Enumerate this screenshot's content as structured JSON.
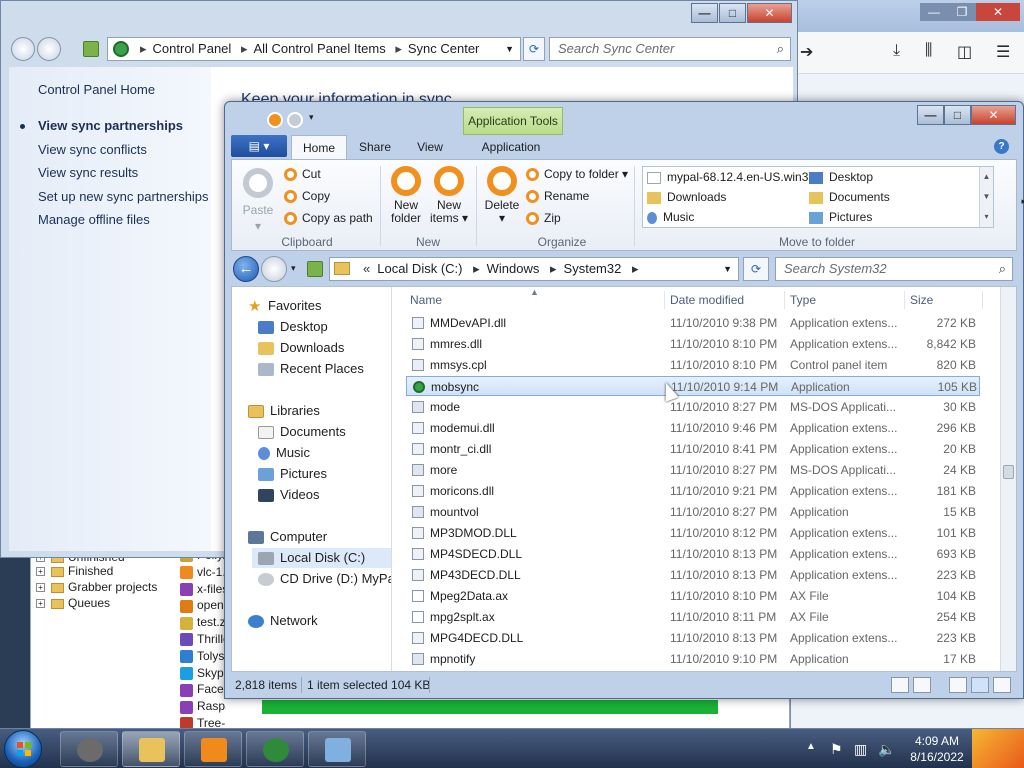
{
  "sync_center": {
    "window_title": "",
    "address": {
      "crumbs": [
        "Control Panel",
        "All Control Panel Items",
        "Sync Center"
      ],
      "search_placeholder": "Search Sync Center"
    },
    "sidebar": {
      "home": "Control Panel Home",
      "links": [
        {
          "label": "View sync partnerships",
          "active": true
        },
        {
          "label": "View sync conflicts",
          "active": false
        },
        {
          "label": "View sync results",
          "active": false
        },
        {
          "label": "Set up new sync partnerships",
          "active": false
        },
        {
          "label": "Manage offline files",
          "active": false
        }
      ]
    },
    "heading": "Keep your information in sync"
  },
  "background_window": {
    "tree": [
      {
        "label": "Unfinished"
      },
      {
        "label": "Finished"
      },
      {
        "label": "Grabber projects"
      },
      {
        "label": "Queues"
      }
    ],
    "files": [
      {
        "label": "Polly.s",
        "color": "#c9a23a"
      },
      {
        "label": "vlc-1.1",
        "color": "#f08a1c"
      },
      {
        "label": "x-files.r",
        "color": "#8b3fb4"
      },
      {
        "label": "openvp",
        "color": "#e07a12"
      },
      {
        "label": "test.zip",
        "color": "#d6b13b"
      },
      {
        "label": "Thriller",
        "color": "#6c4bb8"
      },
      {
        "label": "Tolysh",
        "color": "#2f7fd0"
      },
      {
        "label": "SkypeS",
        "color": "#1aa0e0"
      },
      {
        "label": "Facebo",
        "color": "#8b3fb4"
      },
      {
        "label": "RaspSess",
        "color": "#8b3fb4"
      },
      {
        "label": "Tree-Life-",
        "color": "#c03a2b"
      }
    ]
  },
  "explorer": {
    "contextual_tab": "Application Tools",
    "tabs": {
      "file": "",
      "home": "Home",
      "share": "Share",
      "view": "View",
      "application": "Application"
    },
    "ribbon": {
      "clipboard": {
        "label": "Clipboard",
        "paste": "Paste",
        "cut": "Cut",
        "copy": "Copy",
        "copy_as_path": "Copy as path"
      },
      "new": {
        "label": "New",
        "new_folder": [
          "New",
          "folder"
        ],
        "new_items": [
          "New",
          "items ▾"
        ]
      },
      "organize": {
        "label": "Organize",
        "delete": "Delete",
        "copy_to_folder": "Copy to folder ▾",
        "rename": "Rename",
        "zip": "Zip"
      },
      "move_to_folder": {
        "label": "Move to folder",
        "items": [
          "mypal-68.12.4.en-US.win32",
          "Desktop",
          "Downloads",
          "Documents",
          "Music",
          "Pictures"
        ]
      }
    },
    "address": {
      "crumbs": [
        "Local Disk (C:)",
        "Windows",
        "System32"
      ],
      "search_placeholder": "Search System32"
    },
    "nav": {
      "favorites": "Favorites",
      "fav_items": [
        "Desktop",
        "Downloads",
        "Recent Places"
      ],
      "libraries": "Libraries",
      "lib_items": [
        "Documents",
        "Music",
        "Pictures",
        "Videos"
      ],
      "computer": "Computer",
      "computer_items": [
        "Local Disk (C:)",
        "CD Drive (D:) MyPal"
      ],
      "network": "Network"
    },
    "columns": {
      "name": "Name",
      "date": "Date modified",
      "type": "Type",
      "size": "Size"
    },
    "files": [
      {
        "name": "MMDevAPI.dll",
        "date": "11/10/2010 9:38 PM",
        "type": "Application extens...",
        "size": "272 KB",
        "icon": "dll"
      },
      {
        "name": "mmres.dll",
        "date": "11/10/2010 8:10 PM",
        "type": "Application extens...",
        "size": "8,842 KB",
        "icon": "dll"
      },
      {
        "name": "mmsys.cpl",
        "date": "11/10/2010 8:10 PM",
        "type": "Control panel item",
        "size": "820 KB",
        "icon": "cpl"
      },
      {
        "name": "mobsync",
        "date": "11/10/2010 9:14 PM",
        "type": "Application",
        "size": "105 KB",
        "icon": "sync",
        "selected": true
      },
      {
        "name": "mode",
        "date": "11/10/2010 8:27 PM",
        "type": "MS-DOS Applicati...",
        "size": "30 KB",
        "icon": "exe"
      },
      {
        "name": "modemui.dll",
        "date": "11/10/2010 9:46 PM",
        "type": "Application extens...",
        "size": "296 KB",
        "icon": "dll"
      },
      {
        "name": "montr_ci.dll",
        "date": "11/10/2010 8:41 PM",
        "type": "Application extens...",
        "size": "20 KB",
        "icon": "dll"
      },
      {
        "name": "more",
        "date": "11/10/2010 8:27 PM",
        "type": "MS-DOS Applicati...",
        "size": "24 KB",
        "icon": "exe"
      },
      {
        "name": "moricons.dll",
        "date": "11/10/2010 9:21 PM",
        "type": "Application extens...",
        "size": "181 KB",
        "icon": "dll"
      },
      {
        "name": "mountvol",
        "date": "11/10/2010 8:27 PM",
        "type": "Application",
        "size": "15 KB",
        "icon": "exe"
      },
      {
        "name": "MP3DMOD.DLL",
        "date": "11/10/2010 8:12 PM",
        "type": "Application extens...",
        "size": "101 KB",
        "icon": "dll"
      },
      {
        "name": "MP4SDECD.DLL",
        "date": "11/10/2010 8:13 PM",
        "type": "Application extens...",
        "size": "693 KB",
        "icon": "dll"
      },
      {
        "name": "MP43DECD.DLL",
        "date": "11/10/2010 8:13 PM",
        "type": "Application extens...",
        "size": "223 KB",
        "icon": "dll"
      },
      {
        "name": "Mpeg2Data.ax",
        "date": "11/10/2010 8:10 PM",
        "type": "AX File",
        "size": "104 KB",
        "icon": "file"
      },
      {
        "name": "mpg2splt.ax",
        "date": "11/10/2010 8:11 PM",
        "type": "AX File",
        "size": "254 KB",
        "icon": "file"
      },
      {
        "name": "MPG4DECD.DLL",
        "date": "11/10/2010 8:13 PM",
        "type": "Application extens...",
        "size": "223 KB",
        "icon": "dll"
      },
      {
        "name": "mpnotify",
        "date": "11/10/2010 9:10 PM",
        "type": "Application",
        "size": "17 KB",
        "icon": "exe"
      }
    ],
    "status": {
      "count": "2,818 items",
      "selection": "1 item selected  104 KB"
    }
  },
  "taskbar": {
    "time": "4:09 AM",
    "date": "8/16/2022"
  },
  "colors": {
    "accent_orange": "#f0901e",
    "selection_blue": "#cfe2f8",
    "taskbar": "#22324d"
  }
}
